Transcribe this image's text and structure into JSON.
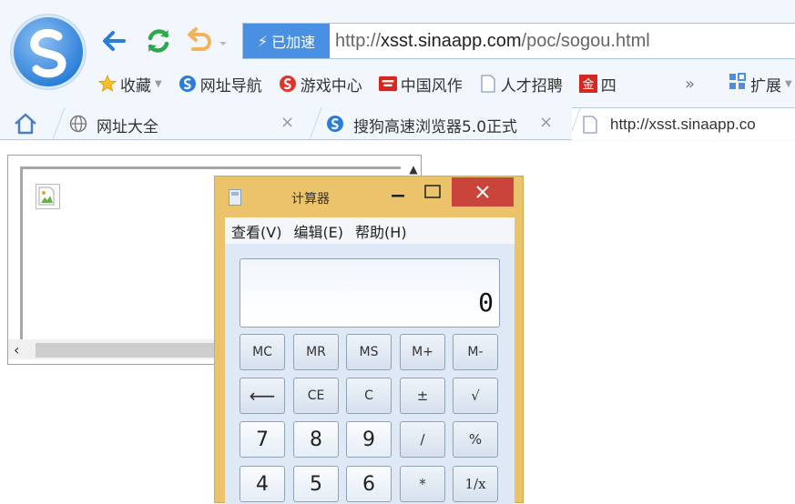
{
  "browser": {
    "accelerate_label": "已加速",
    "url_scheme": "http://",
    "url_host": "xsst.sinaapp.com",
    "url_path": "/poc/sogou.html",
    "bookmarks": [
      {
        "label": "收藏",
        "icon": "star-icon"
      },
      {
        "label": "网址导航",
        "icon": "sogou-logo-icon"
      },
      {
        "label": "游戏中心",
        "icon": "game-center-icon"
      },
      {
        "label": "中国风作",
        "icon": "brand-icon"
      },
      {
        "label": "人才招聘",
        "icon": "page-icon"
      },
      {
        "label": "四",
        "icon": "gold-icon"
      }
    ],
    "more_label": "»",
    "extensions_label": "扩展",
    "tabs": [
      {
        "label": "网址大全",
        "close": "×"
      },
      {
        "label": "搜狗高速浏览器5.0正式",
        "close": "×"
      },
      {
        "label": "http://xsst.sinaapp.co"
      }
    ]
  },
  "calculator": {
    "title": "计算器",
    "menu": [
      "查看(V)",
      "编辑(E)",
      "帮助(H)"
    ],
    "display_value": "0",
    "keys": [
      [
        "MC",
        "MR",
        "MS",
        "M+",
        "M-"
      ],
      [
        "⟵",
        "CE",
        "C",
        "±",
        "√"
      ],
      [
        "7",
        "8",
        "9",
        "/",
        "%"
      ],
      [
        "4",
        "5",
        "6",
        "*",
        "1/x"
      ]
    ]
  },
  "colors": {
    "accent": "#4a90e2",
    "calc_frame": "#eac36b",
    "close_button": "#c9443b",
    "nav_arrow": "#2a7ed9",
    "refresh": "#2ea84a",
    "undo": "#f2b35a"
  }
}
